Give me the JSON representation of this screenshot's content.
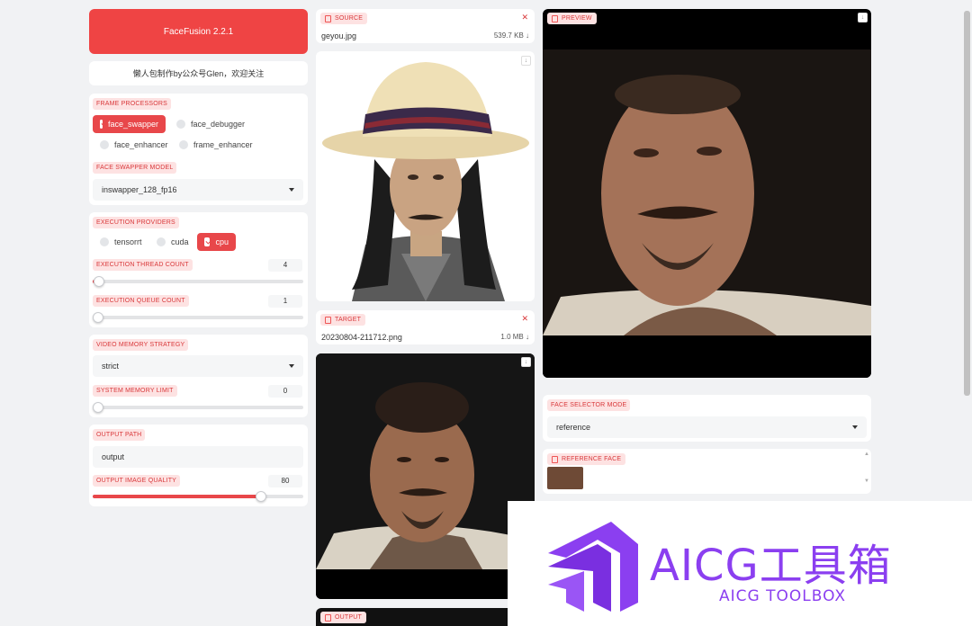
{
  "app": {
    "title": "FaceFusion 2.2.1",
    "subtitle": "懒人包制作by公众号Glen，欢迎关注"
  },
  "frame_processors": {
    "label": "FRAME PROCESSORS",
    "options": [
      {
        "label": "face_swapper",
        "checked": true
      },
      {
        "label": "face_debugger",
        "checked": false
      },
      {
        "label": "face_enhancer",
        "checked": false
      },
      {
        "label": "frame_enhancer",
        "checked": false
      }
    ]
  },
  "face_swapper_model": {
    "label": "FACE SWAPPER MODEL",
    "value": "inswapper_128_fp16"
  },
  "execution": {
    "label": "EXECUTION PROVIDERS",
    "providers": [
      {
        "label": "tensorrt",
        "checked": false
      },
      {
        "label": "cuda",
        "checked": false
      },
      {
        "label": "cpu",
        "checked": true
      }
    ],
    "thread_count": {
      "label": "EXECUTION THREAD COUNT",
      "value": "4",
      "fraction": 0.03
    },
    "queue_count": {
      "label": "EXECUTION QUEUE COUNT",
      "value": "1",
      "fraction": 0.0
    }
  },
  "memory": {
    "strategy_label": "VIDEO MEMORY STRATEGY",
    "strategy_value": "strict",
    "limit_label": "SYSTEM MEMORY LIMIT",
    "limit_value": "0",
    "limit_fraction": 0.0
  },
  "output": {
    "path_label": "OUTPUT PATH",
    "path_value": "output",
    "quality_label": "OUTPUT IMAGE QUALITY",
    "quality_value": "80",
    "quality_fraction": 0.8
  },
  "source": {
    "label": "SOURCE",
    "filename": "geyou.jpg",
    "size": "539.7 KB ↓"
  },
  "target": {
    "label": "TARGET",
    "filename": "20230804-211712.png",
    "size": "1.0 MB ↓"
  },
  "output_panel": {
    "label": "OUTPUT"
  },
  "preview": {
    "label": "PREVIEW"
  },
  "face_selector": {
    "label": "FACE SELECTOR MODE",
    "value": "reference"
  },
  "reference_face": {
    "label": "REFERENCE FACE"
  },
  "watermark": {
    "title": "AICG工具箱",
    "subtitle": "AICG TOOLBOX"
  },
  "colors": {
    "accent": "#e8474a",
    "brand": "#8b3ff0",
    "background": "#f1f2f4"
  },
  "icons": {
    "close": "close-icon",
    "download": "download-icon",
    "file": "file-icon",
    "check": "check-icon"
  }
}
